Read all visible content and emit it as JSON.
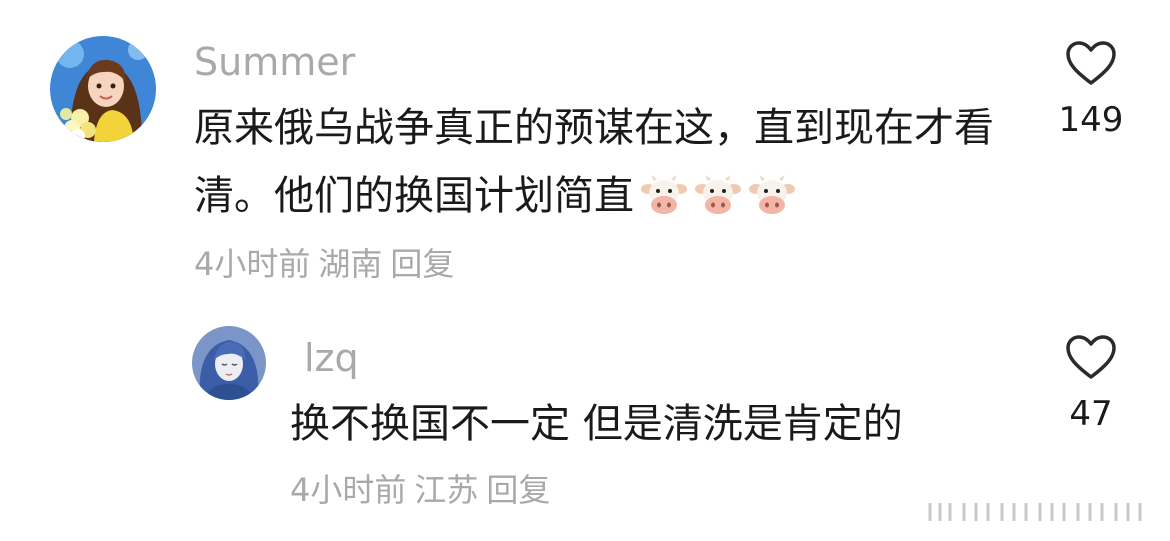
{
  "comments": [
    {
      "username": "Summer",
      "text": "原来俄乌战争真正的预谋在这，直到现在才看清。他们的换国计划简直",
      "emojis": [
        "cow-face",
        "cow-face",
        "cow-face"
      ],
      "time": "4小时前",
      "location": "湖南",
      "reply_label": "回复",
      "likes": "149"
    },
    {
      "username": "lzq",
      "text": "换不换国不一定 但是清洗是肯定的",
      "time": "4小时前",
      "location": "江苏",
      "reply_label": "回复",
      "likes": "47"
    }
  ],
  "icons": {
    "like": "heart-outline-icon",
    "emoji": "cow-face-emoji",
    "watermark": "weibo-watermark"
  },
  "colors": {
    "text": "#1a1a1a",
    "secondary": "#a9a9a9",
    "background": "#ffffff"
  }
}
